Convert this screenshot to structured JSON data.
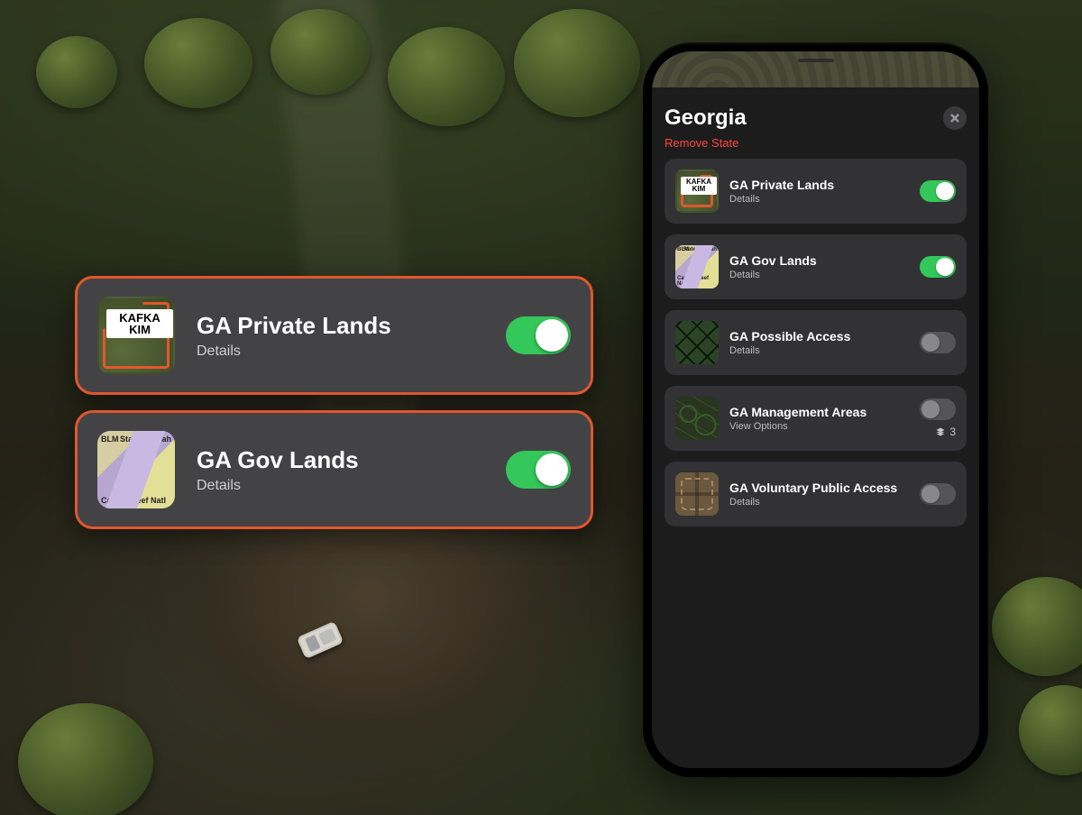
{
  "page_title": "Georgia",
  "remove_label": "Remove State",
  "close_icon_name": "close-icon",
  "layers": [
    {
      "id": "private",
      "title": "GA Private Lands",
      "sub": "Details",
      "on": true
    },
    {
      "id": "gov",
      "title": "GA Gov Lands",
      "sub": "Details",
      "on": true
    },
    {
      "id": "possible",
      "title": "GA Possible Access",
      "sub": "Details",
      "on": false
    },
    {
      "id": "mgmt",
      "title": "GA Management Areas",
      "sub": "View Options",
      "on": false,
      "stack_count": 3
    },
    {
      "id": "vpa",
      "title": "GA Voluntary Public Access",
      "sub": "Details",
      "on": false
    }
  ],
  "private_thumb_label": "KAFKA KIM",
  "gov_thumb_labels": {
    "tl": "BLM",
    "tr": "State Of Utah",
    "bl": "Capitol Reef Natl"
  },
  "callouts": [
    {
      "ref": 0
    },
    {
      "ref": 1
    }
  ],
  "colors": {
    "accent": "#e1572c",
    "switch_on": "#34c759",
    "card": "#323235",
    "sheet": "#1c1c1d"
  }
}
